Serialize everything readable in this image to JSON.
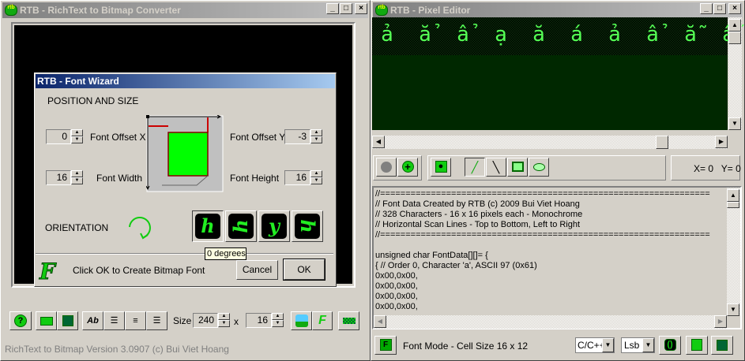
{
  "left_window": {
    "title": "RTB - RichText to Bitmap Converter",
    "app_icon_text": "rtb",
    "wizard": {
      "title": "RTB - Font Wizard",
      "section": "POSITION AND SIZE",
      "font_offset_x_label": "Font Offset X",
      "font_offset_x": "0",
      "font_offset_y_label": "Font Offset Y",
      "font_offset_y": "-3",
      "font_width_label": "Font Width",
      "font_width": "16",
      "font_height_label": "Font Height",
      "font_height": "16",
      "orientation_label": "ORIENTATION",
      "orientation_glyphs": [
        "h",
        "h",
        "y",
        "h"
      ],
      "tooltip": "0 degrees",
      "hint": "Click OK to Create Bitmap Font",
      "cancel": "Cancel",
      "ok": "OK"
    },
    "toolbar": {
      "size_label": "Size",
      "width": "240",
      "x_label": "x",
      "height": "16"
    },
    "status": "RichText to Bitmap Version 3.0907 (c) Bui Viet Hoang"
  },
  "right_window": {
    "title": "RTB - Pixel Editor",
    "app_icon_text": "rtb",
    "pixel_chars": [
      "ả",
      "ẳ",
      "ẩ",
      "ạ",
      "ă",
      "á",
      "ả",
      "ẩ",
      "ẵ",
      "ấ"
    ],
    "coords": "X= 0   Y= 0",
    "code_lines": [
      "//=================================================================",
      "// Font Data Created by RTB (c) 2009 Bui Viet Hoang",
      "// 328 Characters - 16 x 16 pixels each - Monochrome",
      "// Horizontal Scan Lines - Top to Bottom, Left to Right",
      "//=================================================================",
      "",
      "unsigned char FontData[][]= {",
      "{ // Order 0, Character 'a', ASCII 97 (0x61)",
      "0x00,0x00,",
      "0x00,0x00,",
      "0x00,0x00,",
      "0x00,0x00,"
    ],
    "status": "Font Mode - Cell Size 16 x 12",
    "language": "C/C++",
    "bit_order": "Lsb"
  }
}
